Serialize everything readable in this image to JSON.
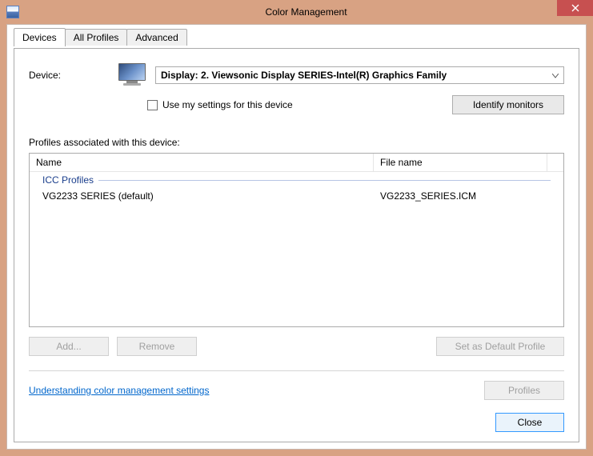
{
  "window": {
    "title": "Color Management",
    "close_tooltip": "Close"
  },
  "tabs": [
    {
      "label": "Devices"
    },
    {
      "label": "All Profiles"
    },
    {
      "label": "Advanced"
    }
  ],
  "device": {
    "label": "Device:",
    "selected": "Display: 2. Viewsonic Display SERIES-Intel(R) Graphics Family",
    "use_my_settings_label": "Use my settings for this device",
    "identify_button": "Identify monitors"
  },
  "profiles": {
    "section_label": "Profiles associated with this device:",
    "columns": {
      "name": "Name",
      "file": "File name"
    },
    "group_label": "ICC Profiles",
    "items": [
      {
        "name": "VG2233 SERIES (default)",
        "file": "VG2233_SERIES.ICM"
      }
    ]
  },
  "buttons": {
    "add": "Add...",
    "remove": "Remove",
    "set_default": "Set as Default Profile",
    "profiles": "Profiles",
    "close": "Close"
  },
  "link": {
    "understanding": "Understanding color management settings"
  }
}
